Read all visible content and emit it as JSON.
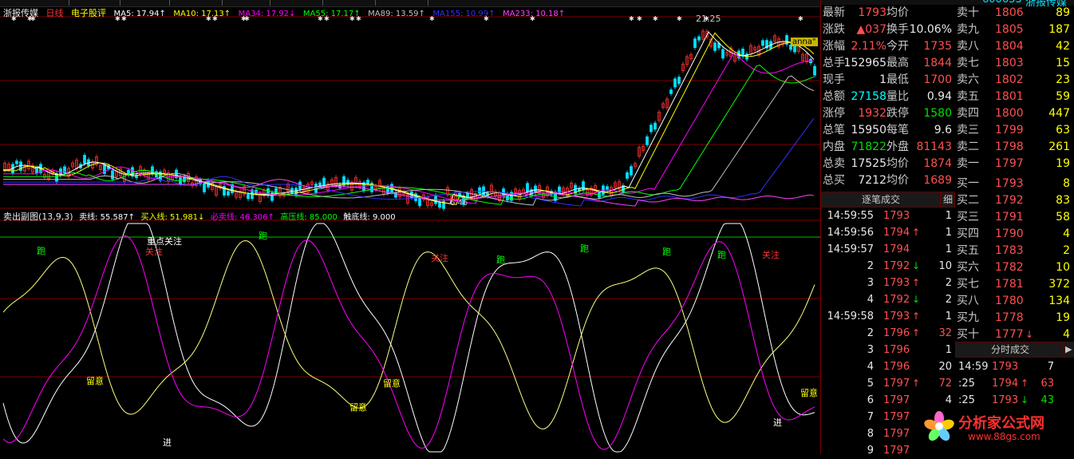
{
  "header": {
    "stock_name": "浙报传媒",
    "period": "日线",
    "sector": "电子股评",
    "ma": [
      {
        "label": "MA5: 17.94↑",
        "color": "#ffffff"
      },
      {
        "label": "MA10: 17.13↑",
        "color": "#ffff00"
      },
      {
        "label": "MA34: 17.92↓",
        "color": "#ff00ff"
      },
      {
        "label": "MA55: 17.17↑",
        "color": "#00ff00"
      },
      {
        "label": "MA89: 13.59↑",
        "color": "#c0c0c0"
      },
      {
        "label": "MA155: 10.99↑",
        "color": "#3030ff"
      },
      {
        "label": "MA233: 10.18↑",
        "color": "#ff40ff"
      }
    ],
    "top_stock_code": "600633",
    "top_stock_name": "浙报传媒"
  },
  "main_chart": {
    "high_label": "21.25",
    "low_label": "6.46",
    "tag": "anna\""
  },
  "sub_chart": {
    "title": "卖出副图(13,9,3)",
    "lines": [
      {
        "label": "卖线: 55.587↑",
        "color": "#ffffff"
      },
      {
        "label": "买入线: 51.981↓",
        "color": "#ffff00"
      },
      {
        "label": "必卖线: 46.306↑",
        "color": "#ff00ff"
      },
      {
        "label": "高压线: 85.000",
        "color": "#00ff00"
      },
      {
        "label": "触底线: 9.000",
        "color": "#ffffff"
      }
    ],
    "annotations": {
      "pao": "跑",
      "guanzhu": "关注",
      "liuyi": "留意",
      "jin": "进",
      "zhongdian": "重点关注"
    }
  },
  "quote": {
    "rows": [
      {
        "l1": "最新",
        "v1": "1793",
        "c1": "red",
        "l2": "均价",
        "v2": "",
        "c2": "red"
      },
      {
        "l1": "涨跌",
        "v1": "▲037",
        "c1": "red",
        "l2": "换手",
        "v2": "10.06%",
        "c2": "white"
      },
      {
        "l1": "涨幅",
        "v1": "2.11%",
        "c1": "red",
        "l2": "今开",
        "v2": "1735",
        "c2": "red"
      },
      {
        "l1": "总手",
        "v1": "152965",
        "c1": "white",
        "l2": "最高",
        "v2": "1844",
        "c2": "red"
      },
      {
        "l1": "现手",
        "v1": "1",
        "c1": "white",
        "l2": "最低",
        "v2": "1700",
        "c2": "red"
      },
      {
        "l1": "总额",
        "v1": "27158",
        "c1": "cyan",
        "l2": "量比",
        "v2": "0.94",
        "c2": "white"
      },
      {
        "l1": "涨停",
        "v1": "1932",
        "c1": "red",
        "l2": "跌停",
        "v2": "1580",
        "c2": "green"
      },
      {
        "l1": "总笔",
        "v1": "15950",
        "c1": "white",
        "l2": "每笔",
        "v2": "9.6",
        "c2": "white"
      },
      {
        "l1": "内盘",
        "v1": "71822",
        "c1": "green",
        "l2": "外盘",
        "v2": "81143",
        "c2": "red"
      },
      {
        "l1": "总卖",
        "v1": "17525",
        "c1": "white",
        "l2": "均价",
        "v2": "1874",
        "c2": "red"
      },
      {
        "l1": "总买",
        "v1": "7212",
        "c1": "white",
        "l2": "均价",
        "v2": "1689",
        "c2": "red"
      }
    ],
    "sell": [
      {
        "label": "卖十",
        "price": "1806",
        "vol": "89"
      },
      {
        "label": "卖九",
        "price": "1805",
        "vol": "187"
      },
      {
        "label": "卖八",
        "price": "1804",
        "vol": "42"
      },
      {
        "label": "卖七",
        "price": "1803",
        "vol": "15"
      },
      {
        "label": "卖六",
        "price": "1802",
        "vol": "23"
      },
      {
        "label": "卖五",
        "price": "1801",
        "vol": "59"
      },
      {
        "label": "卖四",
        "price": "1800",
        "vol": "447"
      },
      {
        "label": "卖三",
        "price": "1799",
        "vol": "63"
      },
      {
        "label": "卖二",
        "price": "1798",
        "vol": "261"
      },
      {
        "label": "卖一",
        "price": "1797",
        "vol": "19"
      }
    ],
    "buy": [
      {
        "label": "买一",
        "price": "1793",
        "vol": "8",
        "arrow": ""
      },
      {
        "label": "买二",
        "price": "1792",
        "vol": "83",
        "arrow": ""
      },
      {
        "label": "买三",
        "price": "1791",
        "vol": "58",
        "arrow": ""
      },
      {
        "label": "买四",
        "price": "1790",
        "vol": "4",
        "arrow": ""
      },
      {
        "label": "买五",
        "price": "1783",
        "vol": "2",
        "arrow": ""
      },
      {
        "label": "买六",
        "price": "1782",
        "vol": "10",
        "arrow": ""
      },
      {
        "label": "买七",
        "price": "1781",
        "vol": "372",
        "arrow": ""
      },
      {
        "label": "买八",
        "price": "1780",
        "vol": "134",
        "arrow": ""
      },
      {
        "label": "买九",
        "price": "1778",
        "vol": "19",
        "arrow": ""
      },
      {
        "label": "买十",
        "price": "1777",
        "vol": "4",
        "arrow": "↓"
      }
    ],
    "ticks_header": "逐笔成交",
    "ticks_btn": "细",
    "ticks": [
      {
        "time": "14:59:55",
        "price": "1793",
        "arrow": "",
        "vol": "1",
        "vc": "white"
      },
      {
        "time": "14:59:56",
        "price": "1794",
        "arrow": "↑",
        "vol": "1",
        "vc": "white"
      },
      {
        "time": "14:59:57",
        "price": "1794",
        "arrow": "",
        "vol": "1",
        "vc": "white"
      },
      {
        "time": "2",
        "price": "1792",
        "arrow": "↓",
        "vol": "10",
        "vc": "white"
      },
      {
        "time": "3",
        "price": "1793",
        "arrow": "↑",
        "vol": "2",
        "vc": "white"
      },
      {
        "time": "4",
        "price": "1792",
        "arrow": "↓",
        "vol": "2",
        "vc": "white"
      },
      {
        "time": "14:59:58",
        "price": "1793",
        "arrow": "↑",
        "vol": "1",
        "vc": "white"
      },
      {
        "time": "2",
        "price": "1796",
        "arrow": "↑",
        "vol": "32",
        "vc": "red"
      },
      {
        "time": "3",
        "price": "1796",
        "arrow": "",
        "vol": "1",
        "vc": "white"
      },
      {
        "time": "4",
        "price": "1796",
        "arrow": "",
        "vol": "20",
        "vc": "white"
      },
      {
        "time": "5",
        "price": "1797",
        "arrow": "↑",
        "vol": "72",
        "vc": "red"
      },
      {
        "time": "6",
        "price": "1797",
        "arrow": "",
        "vol": "4",
        "vc": "white"
      },
      {
        "time": "7",
        "price": "1797",
        "arrow": "",
        "vol": "",
        "vc": "white"
      },
      {
        "time": "8",
        "price": "1797",
        "arrow": "",
        "vol": "",
        "vc": "white"
      },
      {
        "time": "9",
        "price": "1797",
        "arrow": "",
        "vol": "",
        "vc": "white"
      }
    ],
    "fenshi_header": "分时成交",
    "fenshi": [
      {
        "time": "14:59",
        "price": "1793",
        "arrow": "",
        "vol": "7",
        "vc": "white"
      },
      {
        "time": ":25",
        "price": "1794",
        "arrow": "↑",
        "vol": "63",
        "vc": "red"
      },
      {
        "time": ":25",
        "price": "1793",
        "arrow": "↓",
        "vol": "43",
        "vc": "green"
      }
    ]
  },
  "watermark": {
    "title": "分析家公式网",
    "url": "www.88gs.com"
  }
}
